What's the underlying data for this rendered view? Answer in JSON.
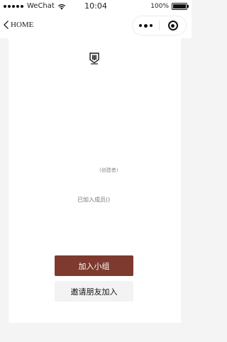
{
  "status_bar": {
    "carrier": "WeChat",
    "time": "10:04",
    "battery": "100%",
    "icons": [
      "signal-dots-icon",
      "wifi-icon",
      "battery-icon"
    ]
  },
  "nav": {
    "back_label": "HOME",
    "icons": [
      "chevron-left-icon",
      "more-icon",
      "close-target-icon"
    ]
  },
  "group": {
    "icon": "group-badge-icon",
    "creator_note": "(创建者)",
    "members_label": "已加入成员()"
  },
  "actions": {
    "join_label": "加入小组",
    "invite_label": "邀请朋友加入"
  },
  "colors": {
    "primary": "#7e3a2e",
    "secondary_bg": "#f3f3f3",
    "page_bg": "#f4f4f4"
  }
}
